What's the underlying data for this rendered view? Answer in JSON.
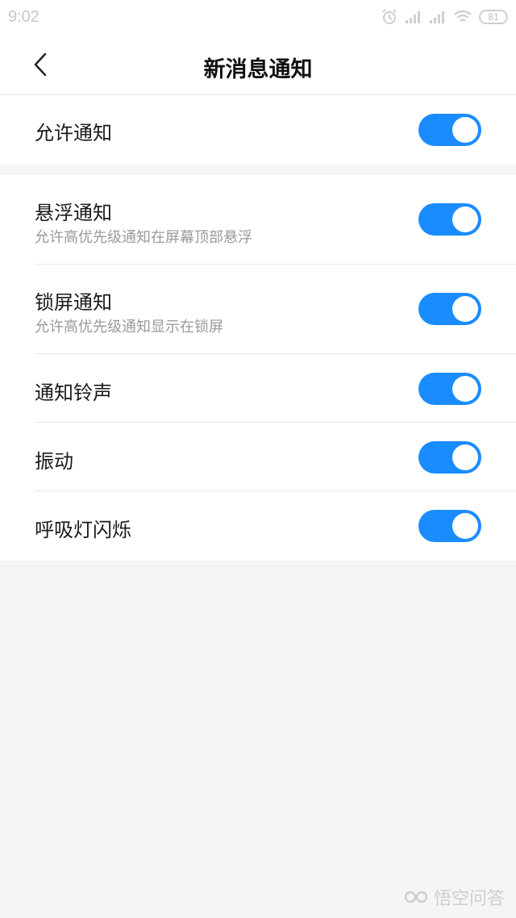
{
  "status_bar": {
    "time": "9:02",
    "battery": "81",
    "icons": [
      "alarm-icon",
      "signal-icon",
      "signal-icon",
      "wifi-icon",
      "battery-icon"
    ]
  },
  "header": {
    "title": "新消息通知",
    "back_icon": "chevron-left-icon"
  },
  "section1": {
    "items": [
      {
        "label": "允许通知",
        "enabled": true
      }
    ]
  },
  "section2": {
    "items": [
      {
        "label": "悬浮通知",
        "sublabel": "允许高优先级通知在屏幕顶部悬浮",
        "enabled": true
      },
      {
        "label": "锁屏通知",
        "sublabel": "允许高优先级通知显示在锁屏",
        "enabled": true
      },
      {
        "label": "通知铃声",
        "enabled": true
      },
      {
        "label": "振动",
        "enabled": true
      },
      {
        "label": "呼吸灯闪烁",
        "enabled": true
      }
    ]
  },
  "watermark": {
    "text": "悟空问答"
  },
  "colors": {
    "accent": "#1a8cff",
    "background": "#f5f5f5",
    "card": "#ffffff"
  }
}
